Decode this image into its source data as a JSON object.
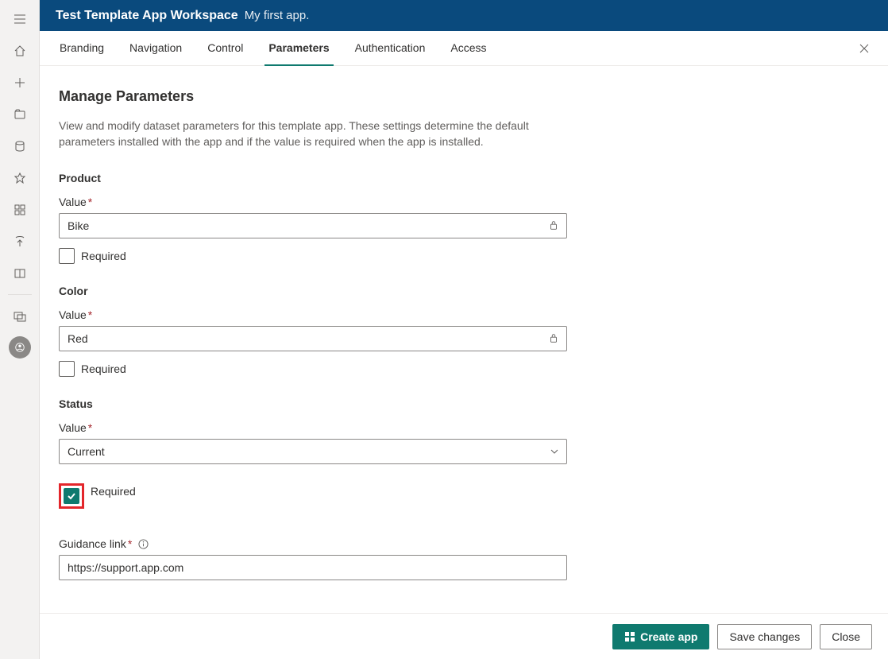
{
  "header": {
    "workspace_title": "Test Template App Workspace",
    "workspace_subtitle": "My first app."
  },
  "tabs": {
    "branding": "Branding",
    "navigation": "Navigation",
    "control": "Control",
    "parameters": "Parameters",
    "authentication": "Authentication",
    "access": "Access",
    "active": "parameters"
  },
  "page": {
    "heading": "Manage Parameters",
    "description": "View and modify dataset parameters for this template app. These settings determine the default parameters installed with the app and if the value is required when the app is installed."
  },
  "labels": {
    "value": "Value",
    "required": "Required",
    "guidance_link": "Guidance link",
    "required_mark": "*"
  },
  "parameters": [
    {
      "name": "Product",
      "type": "text",
      "value": "Bike",
      "locked": true,
      "required": false
    },
    {
      "name": "Color",
      "type": "text",
      "value": "Red",
      "locked": true,
      "required": false
    },
    {
      "name": "Status",
      "type": "select",
      "value": "Current",
      "required": true
    }
  ],
  "guidance_link": {
    "value": "https://support.app.com"
  },
  "footer": {
    "create_app": "Create app",
    "save_changes": "Save changes",
    "close": "Close"
  },
  "colors": {
    "header_bg": "#0a4a7d",
    "accent": "#0f7a6f",
    "highlight_border": "#e3262b"
  }
}
